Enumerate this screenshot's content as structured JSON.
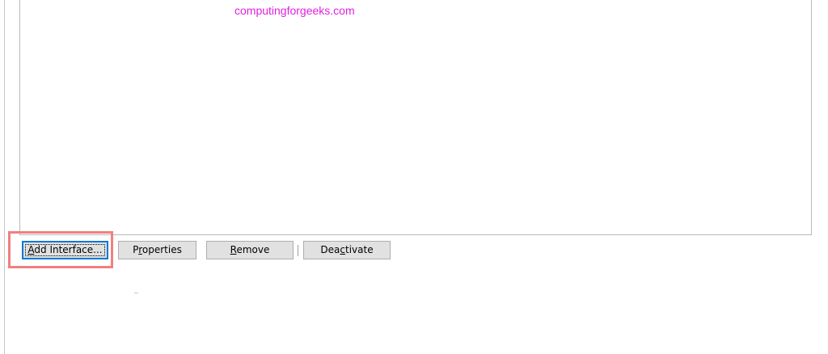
{
  "watermark": {
    "text": "computingforgeeks.com",
    "color": "#e020e0"
  },
  "toolbar": {
    "add_interface": {
      "before": "",
      "mnemonic": "A",
      "after": "dd Interface..."
    },
    "properties": {
      "before": "P",
      "mnemonic": "r",
      "after": "operties"
    },
    "remove": {
      "before": "",
      "mnemonic": "R",
      "after": "emove"
    },
    "deactivate": {
      "before": "Dea",
      "mnemonic": "c",
      "after": "tivate"
    }
  },
  "annotation": {
    "highlight_color": "#f08080",
    "highlight_target": "add-interface-button"
  },
  "colors": {
    "button_face": "#e1e1e1",
    "button_border": "#adadad",
    "focus_border": "#0078d7"
  }
}
